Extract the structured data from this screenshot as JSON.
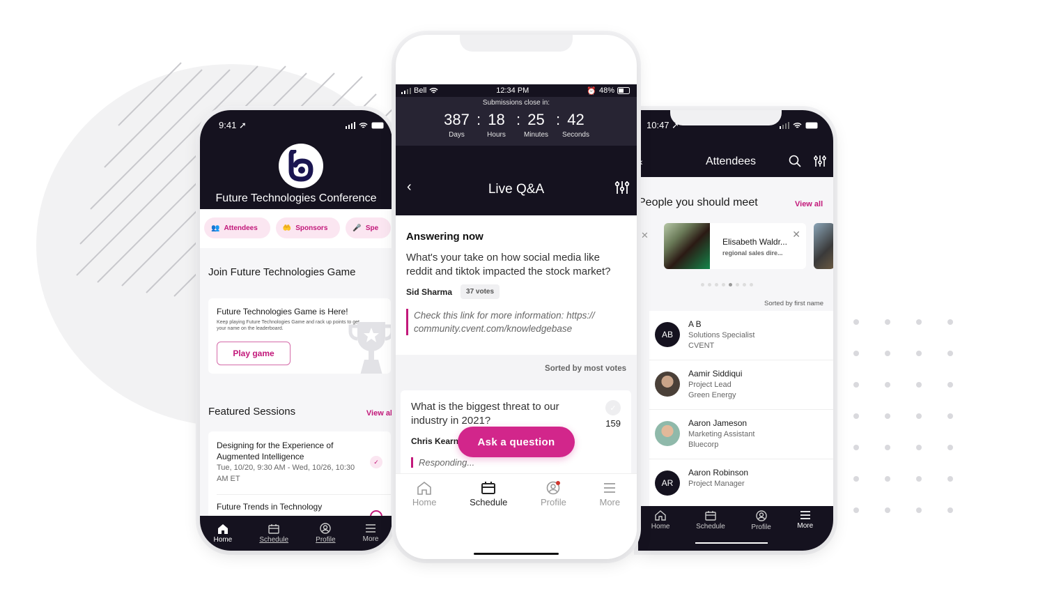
{
  "left_phone": {
    "status": {
      "time": "9:41",
      "location_icon": "location-arrow-icon",
      "signal_icon": "signal-icon",
      "wifi_icon": "wifi-icon",
      "battery_icon": "battery-icon"
    },
    "logo_icon": "b-logo-icon",
    "title": "Future Technologies Conference",
    "chips": [
      {
        "label": "Attendees",
        "icon": "attendees-icon"
      },
      {
        "label": "Sponsors",
        "icon": "sponsors-icon"
      },
      {
        "label": "Spe",
        "icon": "speakers-icon"
      }
    ],
    "game_section_title": "Join Future Technologies Game",
    "game_card": {
      "title": "Future Technologies Game is Here!",
      "description": "Keep playing Future Technologies Game and rack up points to get your name on the leaderboard.",
      "button": "Play game",
      "icon": "trophy-icon"
    },
    "featured": {
      "title": "Featured Sessions",
      "view_all": "View al",
      "sessions": [
        {
          "name": "Designing for the Experience of Augmented Intelligence",
          "when": "Tue, 10/20, 9:30 AM - Wed, 10/26, 10:30 AM ET",
          "checked": true
        },
        {
          "name": "Future Trends in Technology",
          "when": "",
          "checked": false
        }
      ]
    },
    "nav": [
      {
        "label": "Home",
        "icon": "home-icon",
        "active": true
      },
      {
        "label": "Schedule",
        "icon": "calendar-icon",
        "active": false
      },
      {
        "label": "Profile",
        "icon": "profile-icon",
        "active": false
      },
      {
        "label": "More",
        "icon": "menu-icon",
        "active": false
      }
    ]
  },
  "center_phone": {
    "status": {
      "carrier": "Bell",
      "time": "12:34 PM",
      "battery": "48%"
    },
    "countdown": {
      "label": "Submissions close in:",
      "units": [
        {
          "value": "387",
          "unit": "Days"
        },
        {
          "value": "18",
          "unit": "Hours"
        },
        {
          "value": "25",
          "unit": "Minutes"
        },
        {
          "value": "42",
          "unit": "Seconds"
        }
      ],
      "separator": ":"
    },
    "header": {
      "title": "Live Q&A",
      "back_icon": "chevron-left-icon",
      "filter_icon": "filter-sliders-icon"
    },
    "answering": {
      "heading": "Answering now",
      "question": "What's your take on how social media like reddit and tiktok impacted the stock market?",
      "author": "Sid Sharma",
      "votes": "37 votes",
      "response": "Check this link for more information: https:// community.cvent.com/knowledgebase"
    },
    "sort_label": "Sorted by most votes",
    "questions": [
      {
        "text": "What is the biggest threat to our industry in 2021?",
        "author": "Chris Kearn",
        "count": "159",
        "response": "Responding..."
      }
    ],
    "ask_button": "Ask a question",
    "nav": [
      {
        "label": "Home",
        "icon": "home-icon",
        "active": false
      },
      {
        "label": "Schedule",
        "icon": "calendar-icon",
        "active": true
      },
      {
        "label": "Profile",
        "icon": "profile-icon",
        "active": false,
        "badge": true
      },
      {
        "label": "More",
        "icon": "menu-icon",
        "active": false
      }
    ]
  },
  "right_phone": {
    "status": {
      "time": "10:47"
    },
    "header": {
      "title": "Attendees",
      "search_icon": "search-icon",
      "filter_icon": "filter-sliders-icon"
    },
    "people_section": {
      "title": "People you should meet",
      "view_all": "View all"
    },
    "recommendation": {
      "name": "Elisabeth Waldr...",
      "role": "regional sales dire..."
    },
    "carousel": {
      "total": 8,
      "active_index": 4
    },
    "sort_label": "Sorted by first name",
    "attendees": [
      {
        "initials": "AB",
        "name": "A B",
        "title": "Solutions Specialist",
        "company": "CVENT"
      },
      {
        "initials": "",
        "name": "Aamir Siddiqui",
        "title": "Project Lead",
        "company": "Green Energy"
      },
      {
        "initials": "",
        "name": "Aaron Jameson",
        "title": "Marketing Assistant",
        "company": "Bluecorp"
      },
      {
        "initials": "AR",
        "name": "Aaron Robinson",
        "title": "Project Manager",
        "company": ""
      }
    ],
    "nav": [
      {
        "label": "Home",
        "icon": "home-icon",
        "active": false
      },
      {
        "label": "Schedule",
        "icon": "calendar-icon",
        "active": false
      },
      {
        "label": "Profile",
        "icon": "profile-icon",
        "active": false
      },
      {
        "label": "More",
        "icon": "menu-icon",
        "active": true
      }
    ]
  },
  "colors": {
    "brand_dark": "#15121f",
    "accent": "#d2268b",
    "accent_light": "#fbe6f1"
  }
}
